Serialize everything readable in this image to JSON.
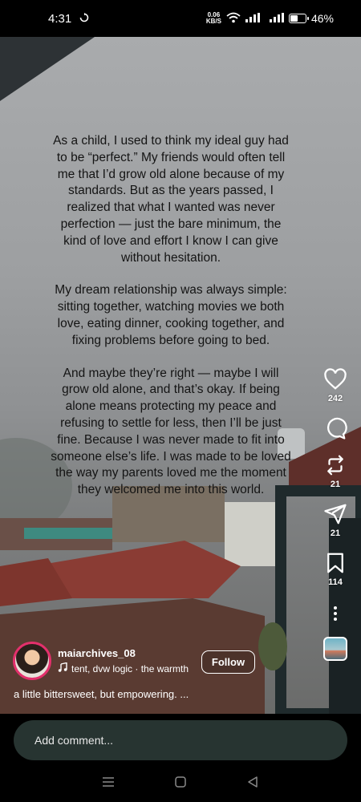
{
  "status_bar": {
    "time": "4:31",
    "net_speed_value": "0.06",
    "net_speed_unit": "KB/S",
    "battery_percent": "46%",
    "battery_level": 0.46
  },
  "post": {
    "text_paragraphs": [
      "As a child, I used to think my ideal guy had to be “perfect.” My friends would often tell me that I’d grow old alone because of my standards. But as the years passed, I realized that what I wanted was never perfection — just the bare minimum, the kind of love and effort I know I can give without hesitation.",
      "My dream relationship was always simple: sitting together, watching movies we both love, eating dinner, cooking together, and fixing problems before going to bed.",
      "And maybe they’re right — maybe I will grow old alone, and that’s okay. If being alone means protecting my peace and refusing to settle for less, then I’ll be just fine. Because I was never made to fit into someone else’s life. I was made to be loved the way my parents loved me the moment they welcomed me into this world."
    ],
    "username": "maiarchives_08",
    "audio": "tent, dvw logic · the warmth",
    "follow_label": "Follow",
    "caption": "a little bittersweet, but empowering. ..."
  },
  "actions": {
    "likes": "242",
    "reposts": "21",
    "shares": "21",
    "saves": "114",
    "icons": [
      "heart-icon",
      "comment-icon",
      "repost-icon",
      "send-icon",
      "bookmark-icon",
      "more-icon"
    ]
  },
  "comment_bar": {
    "placeholder": "Add comment..."
  },
  "nav": {
    "icons": [
      "recent-apps-icon",
      "home-icon",
      "back-icon"
    ]
  },
  "colors": {
    "avatar_ring": "#e3306c",
    "comment_bar_bg": "#273431",
    "text_overlay": "#141414"
  }
}
